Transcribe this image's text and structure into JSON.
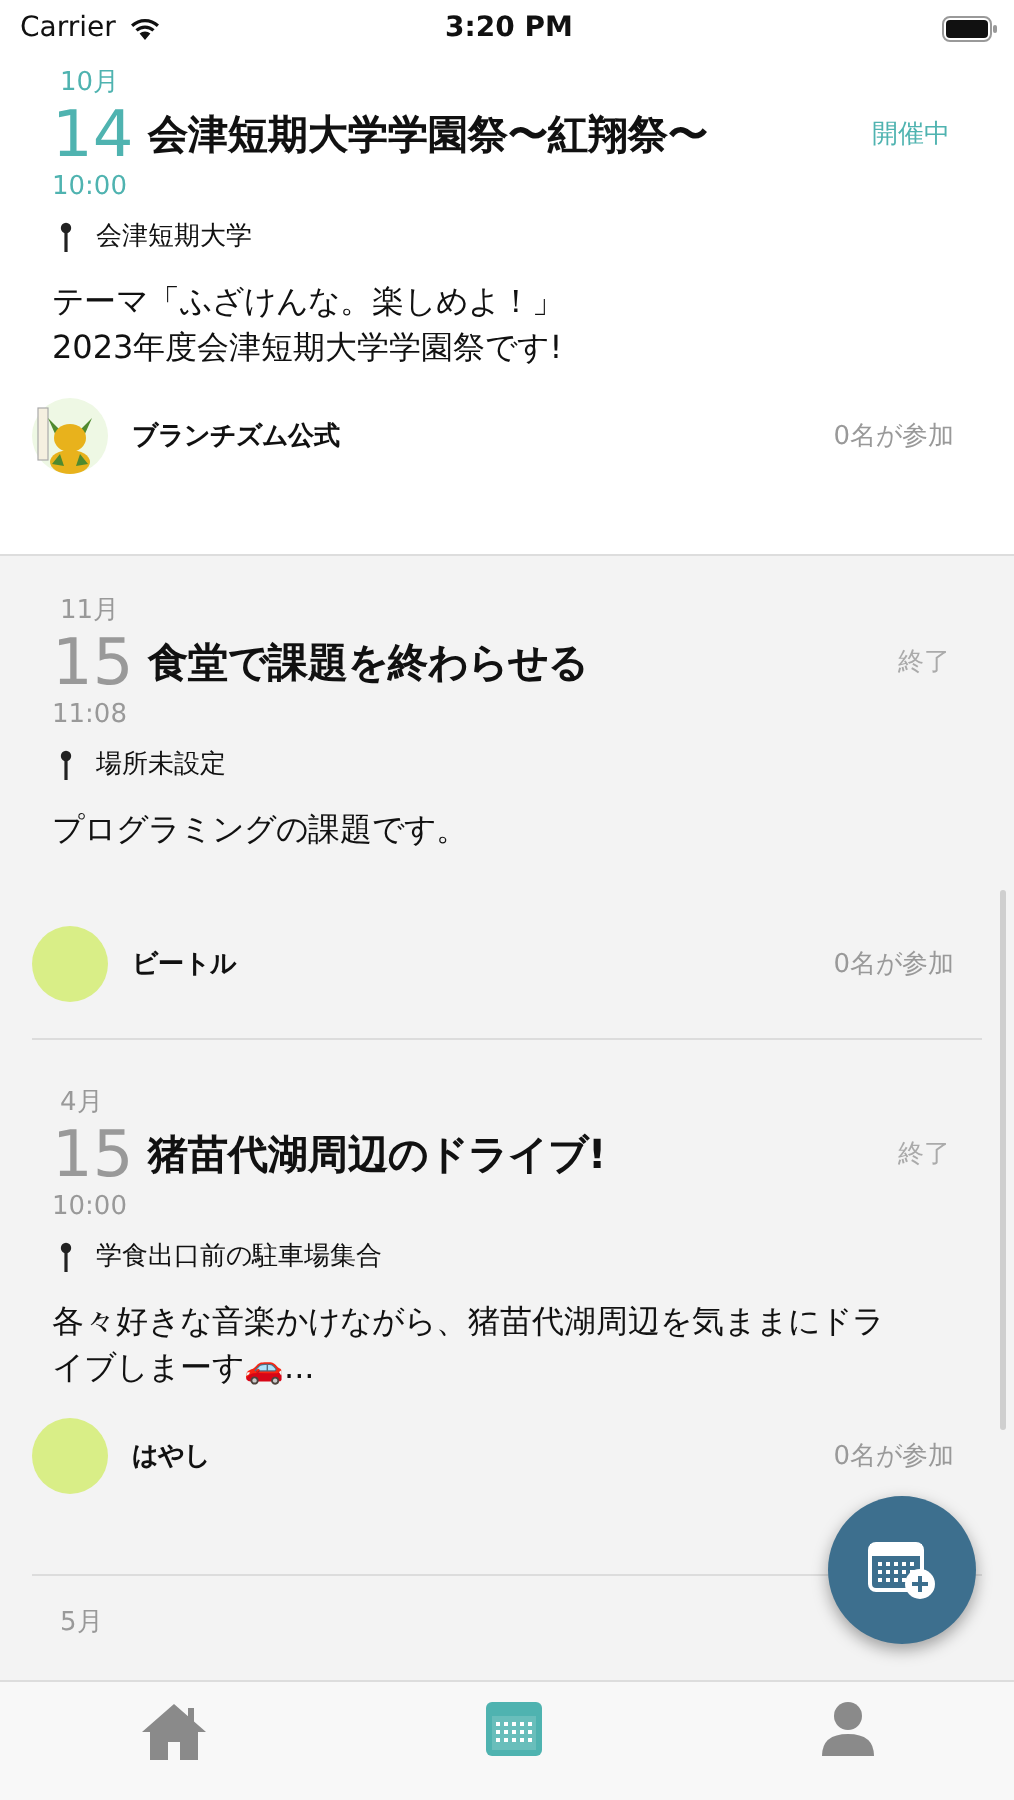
{
  "status_bar": {
    "carrier": "Carrier",
    "time": "3:20 PM"
  },
  "events": [
    {
      "month": "10月",
      "day": "14",
      "time": "10:00",
      "title": "会津短期大学学園祭〜紅翔祭〜",
      "status": "開催中",
      "kind": "ongoing",
      "location": "会津短期大学",
      "description": "テーマ「ふざけんな。楽しめよ！」\n2023年度会津短期大学学園祭です!",
      "host": {
        "name": "ブランチズム公式",
        "kind": "picture"
      },
      "participants": "0名が参加"
    },
    {
      "month": "11月",
      "day": "15",
      "time": "11:08",
      "title": "食堂で課題を終わらせる",
      "status": "終了",
      "kind": "ended",
      "location": "場所未設定",
      "description": "プログラミングの課題です。",
      "host": {
        "name": "ビートル",
        "kind": "plain",
        "color": "#d9ee87"
      },
      "participants": "0名が参加"
    },
    {
      "month": "4月",
      "day": "15",
      "time": "10:00",
      "title": "猪苗代湖周辺のドライブ!",
      "status": "終了",
      "kind": "ended",
      "location": "学食出口前の駐車場集合",
      "description": "各々好きな音楽かけながら、猪苗代湖周辺を気ままにドライブしまーす🚗...",
      "host": {
        "name": "はやし",
        "kind": "plain",
        "color": "#d9ee87"
      },
      "participants": "0名が参加"
    },
    {
      "month": "5月",
      "kind": "partial"
    }
  ],
  "tabs": [
    {
      "selected": false
    },
    {
      "selected": true
    },
    {
      "selected": false
    }
  ]
}
